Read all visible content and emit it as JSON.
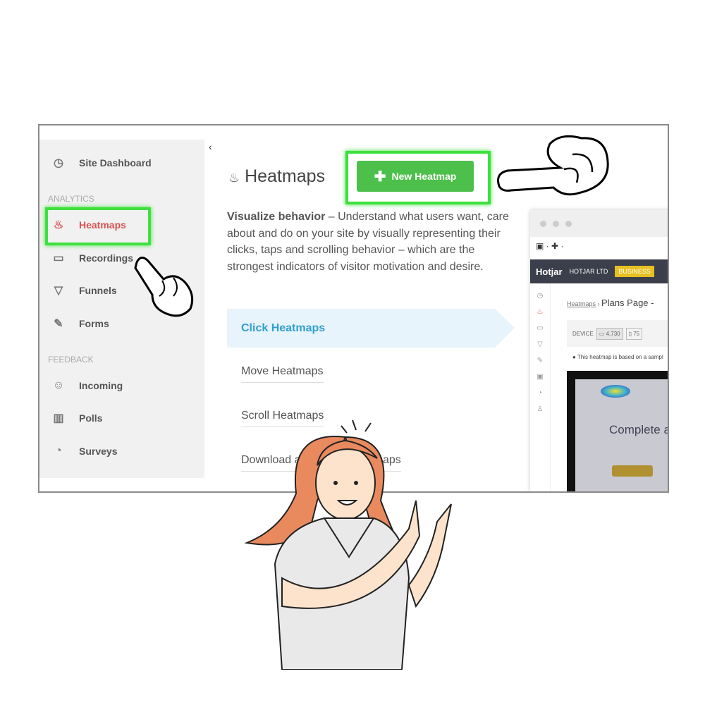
{
  "sidebar": {
    "items": [
      {
        "label": "Site Dashboard",
        "icon": "dashboard-icon"
      },
      {
        "label": "Heatmaps",
        "icon": "flame-icon",
        "active": true
      },
      {
        "label": "Recordings",
        "icon": "video-icon"
      },
      {
        "label": "Funnels",
        "icon": "funnel-icon"
      },
      {
        "label": "Forms",
        "icon": "form-icon"
      },
      {
        "label": "Incoming",
        "icon": "inbox-icon"
      },
      {
        "label": "Polls",
        "icon": "poll-icon"
      },
      {
        "label": "Surveys",
        "icon": "survey-icon"
      }
    ],
    "sections": {
      "analytics": "ANALYTICS",
      "feedback": "FEEDBACK"
    }
  },
  "main": {
    "title": "Heatmaps",
    "new_button": "New Heatmap",
    "desc_bold": "Visualize behavior",
    "desc": " – Understand what users want, care about and do on your site by visually representing their clicks, taps and scrolling behavior – which are the strongest indicators of visitor motivation and desire.",
    "tabs": [
      "Click Heatmaps",
      "Move Heatmaps",
      "Scroll Heatmaps",
      "Download and Share Heatmaps"
    ]
  },
  "preview": {
    "brand": "Hotjar",
    "org": "HOTJAR LTD",
    "plan": "BUSINESS",
    "breadcrumb": "Heatmaps",
    "page": "Plans Page -",
    "device_label": "DEVICE",
    "desktop_count": "4,730",
    "tablet_count": "75",
    "note": "This heatmap is based on a sampl",
    "content": "Complete a"
  },
  "colors": {
    "accent_green": "#4cc04a",
    "highlight": "#3ee03e",
    "active_red": "#d9534f",
    "link_blue": "#2f9fd0"
  }
}
